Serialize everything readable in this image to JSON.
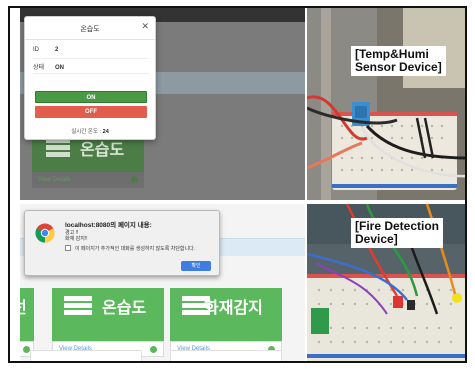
{
  "modal": {
    "title": "온습도",
    "close_glyph": "✕",
    "id_label": "ID",
    "id_value": "2",
    "state_label": "상태",
    "state_value": "ON",
    "on_label": "ON",
    "off_label": "OFF",
    "temp_label": "실시간 온도 :",
    "temp_value": "24"
  },
  "top_tile": {
    "title": "온습도",
    "footer": "View Details"
  },
  "dialog": {
    "host": "localhost:8080의 페이지 내용:",
    "msg1": "경고 !!",
    "msg2": "화재 감지!!",
    "checkbox_label": "이 페이지가 추가적인 대화를 생성하지 않도록 차단합니다.",
    "ok_label": "확인"
  },
  "tiles": [
    {
      "title": "선",
      "footer": "View Details"
    },
    {
      "title": "온습도",
      "footer": "View Details"
    },
    {
      "title": "화재감지",
      "footer": "View Details"
    }
  ],
  "photos": {
    "top_label_line1": "[Temp&Humi",
    "top_label_line2": "Sensor Device]",
    "bottom_label_line1": "[Fire Detection",
    "bottom_label_line2": "Device]"
  },
  "colors": {
    "tile_green": "#5cb85c",
    "on_green": "#4a9a45",
    "off_red": "#e35d4c",
    "link_blue": "#5a9bd5",
    "dialog_button_blue": "#3e7ee0"
  },
  "icons": [
    "list-icon",
    "arrow-circle-right-icon",
    "chrome-icon",
    "close-icon"
  ]
}
